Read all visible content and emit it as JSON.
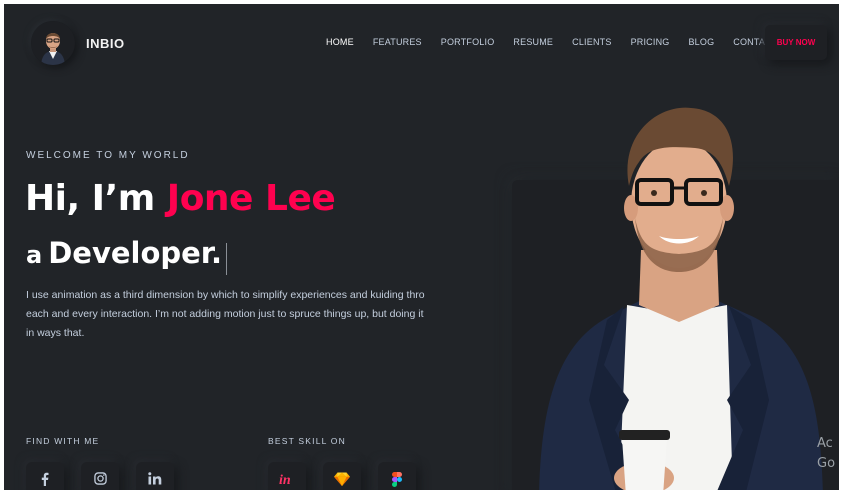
{
  "header": {
    "brand": "INBIO",
    "nav": [
      "HOME",
      "FEATURES",
      "PORTFOLIO",
      "RESUME",
      "CLIENTS",
      "PRICING",
      "BLOG",
      "CONTACT"
    ],
    "active_nav": "HOME",
    "cta_label": "BUY NOW"
  },
  "hero": {
    "welcome": "WELCOME TO MY WORLD",
    "greeting": "Hi, I’m ",
    "name": "Jone Lee",
    "role_prefix": "a",
    "role_word": "Developer.",
    "description": "I use animation as a third dimension by which to simplify experiences and kuiding thro each and every interaction. I’m not adding motion just to spruce things up, but doing it in ways that."
  },
  "find_with_me": {
    "title": "FIND WITH ME",
    "icons": [
      "facebook-icon",
      "instagram-icon",
      "linkedin-icon"
    ]
  },
  "best_skill": {
    "title": "BEST SKILL ON",
    "icons": [
      "invision-icon",
      "sketch-icon",
      "figma-icon"
    ]
  },
  "overlay": {
    "line1": "Ac",
    "line2": "Go"
  },
  "colors": {
    "background": "#212428",
    "accent": "#ff014f",
    "text": "#c4cfde"
  }
}
